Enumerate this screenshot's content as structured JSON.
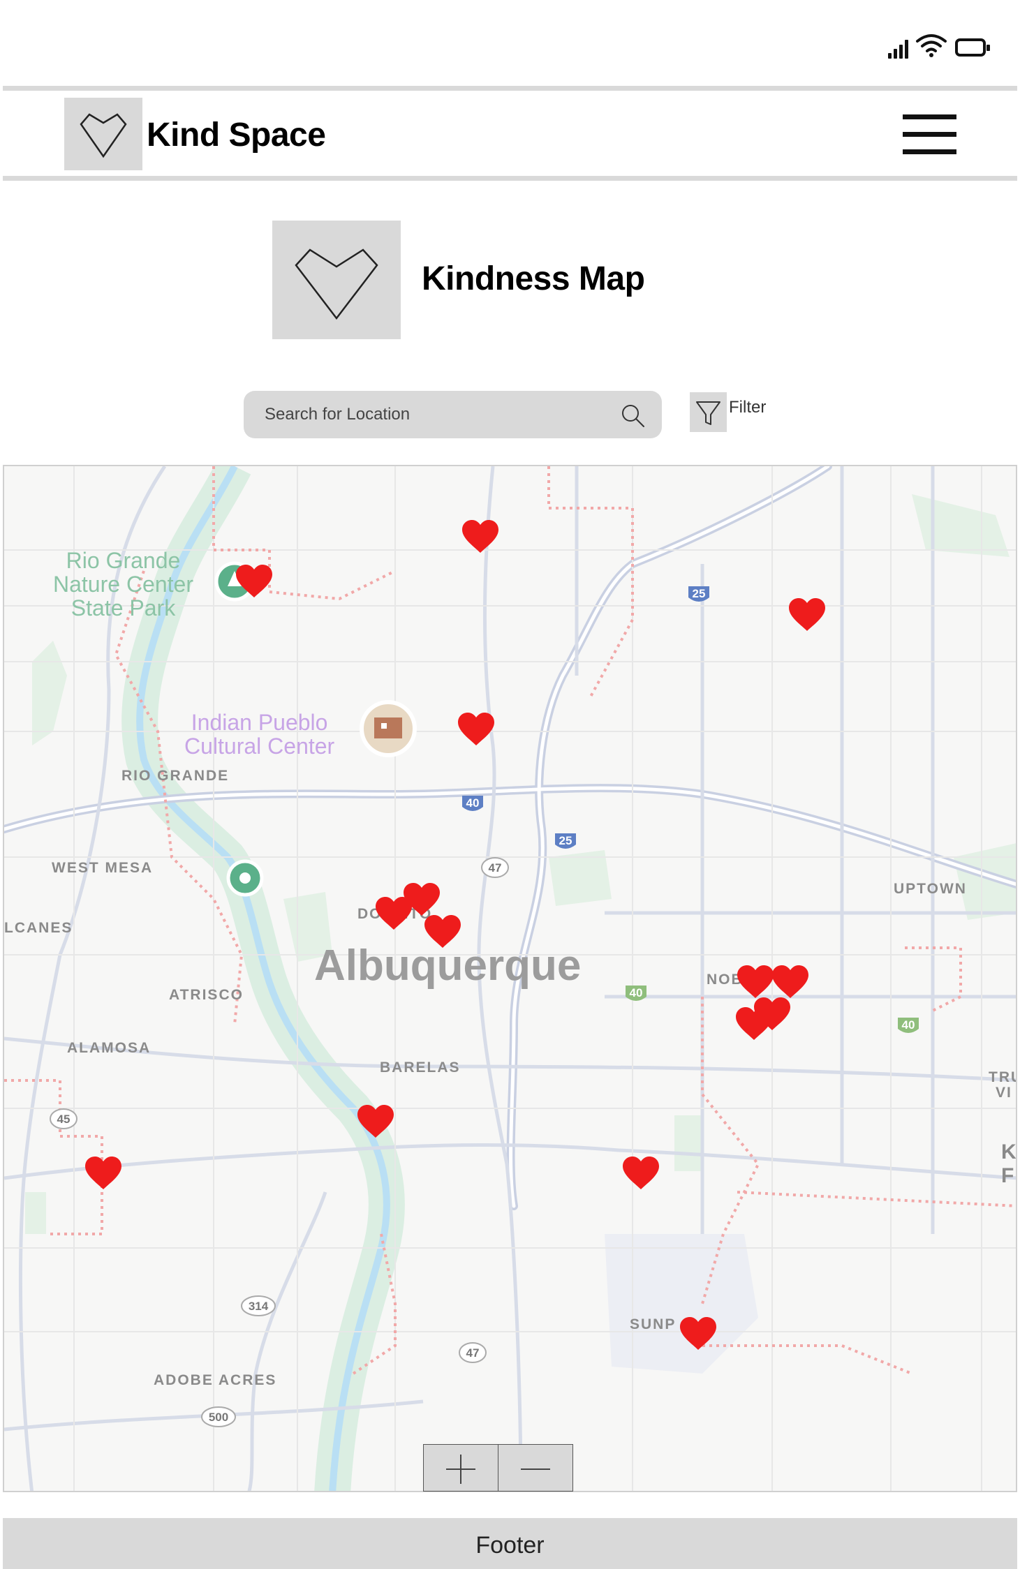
{
  "header": {
    "app_title": "Kind Space",
    "logo_icon": "heart-outline-icon",
    "menu_icon": "hamburger-menu-icon"
  },
  "page": {
    "title": "Kindness Map",
    "hero_icon": "heart-outline-icon"
  },
  "search": {
    "placeholder": "Search for Location",
    "value": "",
    "icon": "search-icon"
  },
  "filter": {
    "label": "Filter",
    "icon": "filter-funnel-icon"
  },
  "map": {
    "city_label": "Albuquerque",
    "park_label": [
      "Rio Grande",
      "Nature Center",
      "State Park"
    ],
    "poi_label": [
      "Indian Pueblo",
      "Cultural Center"
    ],
    "area_labels": {
      "rio_grande": "RIO GRANDE",
      "west_mesa": "WEST MESA",
      "volcanes": "LCANES",
      "downtown": "DOWNTO",
      "atrisco": "ATRISCO",
      "alamosa": "ALAMOSA",
      "barelas": "BARELAS",
      "nob": "NOB",
      "uptown": "UPTOWN",
      "sunport": "SUNP",
      "adobe_acres": "ADOBE ACRES",
      "tru_vi_1": "TRU",
      "tru_vi_2": "VI",
      "k_f_1": "K",
      "k_f_2": "F"
    },
    "highway_shields": [
      "25",
      "25",
      "40",
      "40",
      "40",
      "47",
      "47",
      "45",
      "314",
      "500"
    ],
    "marker_icon": "heart-marker-icon",
    "marker_color": "#ee1c1c",
    "marker_count": 16
  },
  "zoom": {
    "in_icon": "plus-icon",
    "out_icon": "minus-icon"
  },
  "footer": {
    "text": "Footer"
  }
}
